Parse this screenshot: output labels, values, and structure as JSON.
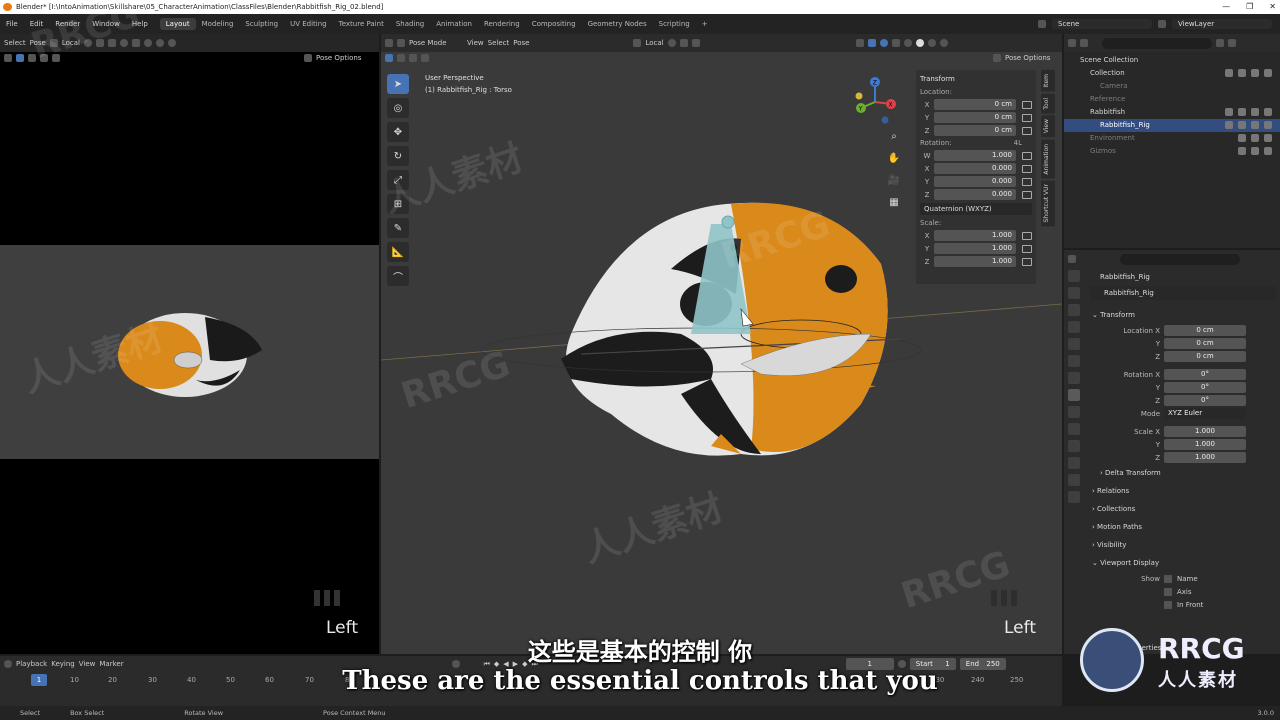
{
  "window": {
    "title": "Blender* [I:\\IntoAnimation\\Skillshare\\05_CharacterAnimation\\ClassFiles\\Blender\\Rabbitfish_Rig_02.blend]",
    "controls": [
      "—",
      "❐",
      "✕"
    ]
  },
  "menu": [
    "File",
    "Edit",
    "Render",
    "Window",
    "Help"
  ],
  "workspaces": [
    "Layout",
    "Modeling",
    "Sculpting",
    "UV Editing",
    "Texture Paint",
    "Shading",
    "Animation",
    "Rendering",
    "Compositing",
    "Geometry Nodes",
    "Scripting"
  ],
  "active_workspace": "Layout",
  "scene": {
    "label": "Scene",
    "view_layer": "ViewLayer"
  },
  "left_view": {
    "header": {
      "select": "Select",
      "pose": "Pose",
      "orientation": "Local",
      "pose_options": "Pose Options"
    },
    "overlay_label": "Left"
  },
  "main_view": {
    "header": {
      "mode": "Pose Mode",
      "view": "View",
      "select": "Select",
      "pose": "Pose",
      "orientation": "Local",
      "pose_options": "Pose Options"
    },
    "info_line1": "User Perspective",
    "info_line2": "(1) Rabbitfish_Rig : Torso",
    "overlay_label": "Left",
    "gizmo_axes": [
      "X",
      "Y",
      "Z"
    ]
  },
  "npanel": {
    "title": "Transform",
    "location_label": "Location:",
    "location": [
      {
        "axis": "X",
        "value": "0 cm"
      },
      {
        "axis": "Y",
        "value": "0 cm"
      },
      {
        "axis": "Z",
        "value": "0 cm"
      }
    ],
    "rotation_label": "Rotation:",
    "rotation_lock": "4L",
    "rotation": [
      {
        "axis": "W",
        "value": "1.000"
      },
      {
        "axis": "X",
        "value": "0.000"
      },
      {
        "axis": "Y",
        "value": "0.000"
      },
      {
        "axis": "Z",
        "value": "0.000"
      }
    ],
    "rotation_mode": "Quaternion (WXYZ)",
    "scale_label": "Scale:",
    "scale": [
      {
        "axis": "X",
        "value": "1.000"
      },
      {
        "axis": "Y",
        "value": "1.000"
      },
      {
        "axis": "Z",
        "value": "1.000"
      }
    ],
    "tabs": [
      "Item",
      "Tool",
      "View",
      "Animation",
      "Shortcut VUr"
    ]
  },
  "outliner": {
    "rows": [
      {
        "name": "Scene Collection",
        "dim": false,
        "sel": false
      },
      {
        "name": "Collection",
        "dim": false,
        "sel": false
      },
      {
        "name": "Camera",
        "dim": true,
        "sel": false
      },
      {
        "name": "Reference",
        "dim": true,
        "sel": false
      },
      {
        "name": "Rabbitfish",
        "dim": false,
        "sel": false
      },
      {
        "name": "Rabbitfish_Rig",
        "dim": false,
        "sel": true
      },
      {
        "name": "Environment",
        "dim": true,
        "sel": false
      },
      {
        "name": "Gizmos",
        "dim": true,
        "sel": false
      }
    ]
  },
  "properties": {
    "object_name": "Rabbitfish_Rig",
    "data_name": "Rabbitfish_Rig",
    "transform_title": "Transform",
    "location": [
      {
        "label": "Location X",
        "value": "0 cm"
      },
      {
        "label": "Y",
        "value": "0 cm"
      },
      {
        "label": "Z",
        "value": "0 cm"
      }
    ],
    "rotation": [
      {
        "label": "Rotation X",
        "value": "0°"
      },
      {
        "label": "Y",
        "value": "0°"
      },
      {
        "label": "Z",
        "value": "0°"
      }
    ],
    "mode_label": "Mode",
    "mode_value": "XYZ Euler",
    "scale": [
      {
        "label": "Scale X",
        "value": "1.000"
      },
      {
        "label": "Y",
        "value": "1.000"
      },
      {
        "label": "Z",
        "value": "1.000"
      }
    ],
    "sections": [
      "Delta Transform",
      "Relations",
      "Collections",
      "Motion Paths",
      "Visibility",
      "Viewport Display"
    ],
    "show_label": "Show",
    "show_items": [
      "Name",
      "Axis",
      "In Front"
    ],
    "footer_section": "Custom Properties"
  },
  "timeline": {
    "menu": [
      "Playback",
      "Keying",
      "View",
      "Marker"
    ],
    "current_frame": "1",
    "start_label": "Start",
    "start": "1",
    "end_label": "End",
    "end": "250",
    "ticks": [
      "1",
      "10",
      "20",
      "30",
      "40",
      "50",
      "60",
      "70",
      "80",
      "230",
      "240",
      "250"
    ]
  },
  "statusbar": {
    "items": [
      "Select",
      "Box Select",
      "Rotate View",
      "Pose Context Menu"
    ],
    "version": "3.0.0"
  },
  "subtitles": {
    "cn": "这些是基本的控制 你",
    "en": "These are the essential controls that you"
  },
  "watermark": {
    "brand": "RRCG",
    "cn": "人人素材",
    "cn_overlay": "人人素材"
  },
  "colors": {
    "accent": "#4772b3",
    "fish_orange": "#d98a1a",
    "fish_white": "#e8e8e8",
    "fish_black": "#1a1a1a",
    "bone": "#8fc4c8"
  }
}
